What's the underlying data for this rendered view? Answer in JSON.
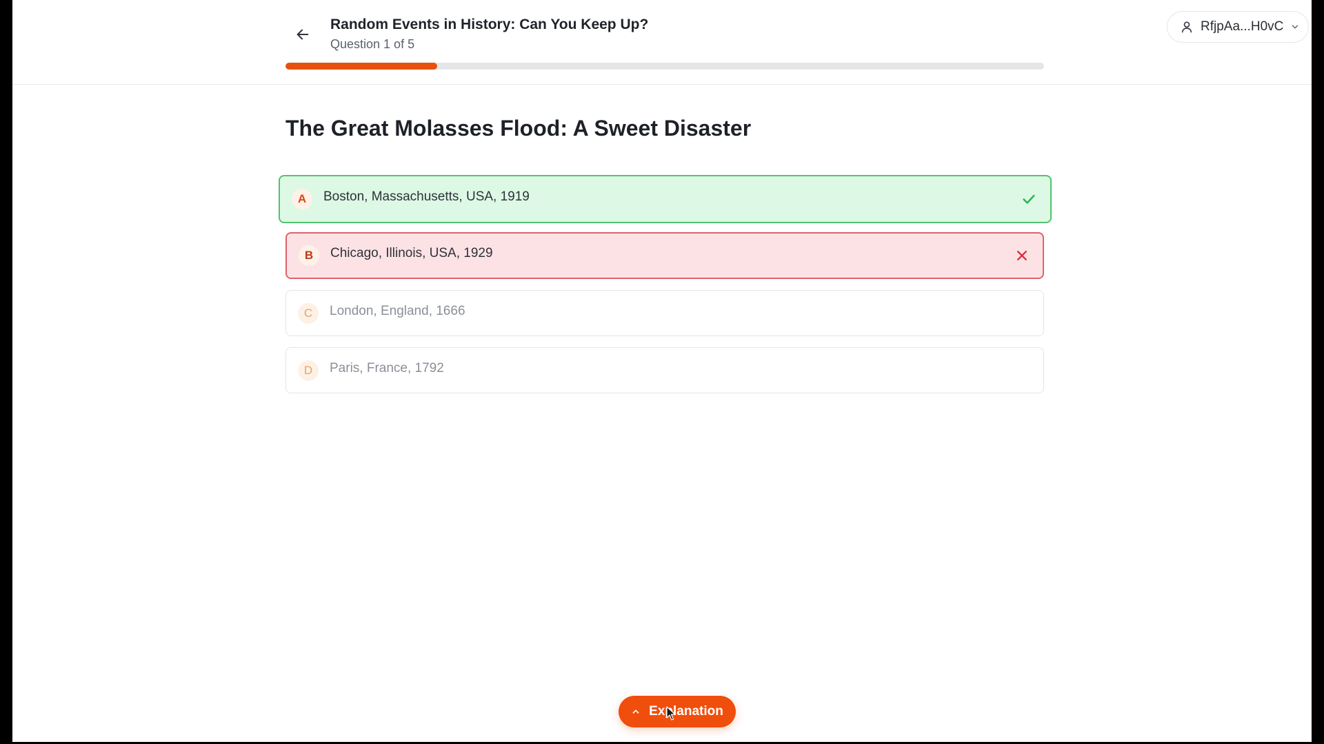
{
  "header": {
    "quiz_title": "Random Events in History: Can You Keep Up?",
    "question_progress": "Question 1 of 5",
    "progress_fraction": 0.2,
    "accent_color": "#e8500e"
  },
  "user_menu": {
    "username": "RfjpAa...H0vC",
    "icons": [
      "user-icon",
      "chevron-down-icon"
    ]
  },
  "question": {
    "title": "The Great Molasses Flood: A Sweet Disaster"
  },
  "options": [
    {
      "letter": "A",
      "text": "Boston, Massachusetts, USA, 1919",
      "state": "correct",
      "mark_icon": "check-icon",
      "color": "#4fc36e"
    },
    {
      "letter": "B",
      "text": "Chicago, Illinois, USA, 1929",
      "state": "incorrect",
      "mark_icon": "close-icon",
      "color": "#d92d3a"
    },
    {
      "letter": "C",
      "text": "London, England, 1666",
      "state": "neutral"
    },
    {
      "letter": "D",
      "text": "Paris, France, 1792",
      "state": "neutral"
    }
  ],
  "footer": {
    "explanation_label": "Explanation",
    "explanation_icon": "chevron-up-icon"
  }
}
